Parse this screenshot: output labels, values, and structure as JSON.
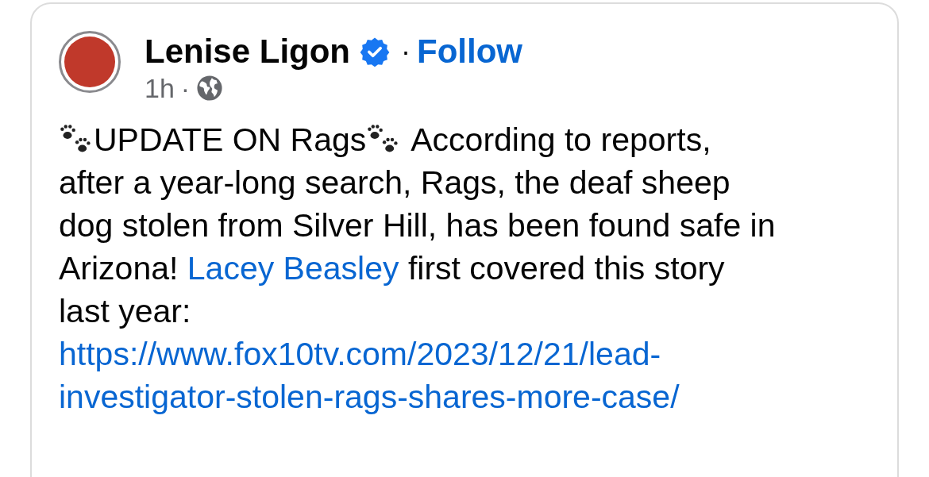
{
  "post": {
    "author": "Lenise Ligon",
    "verified": true,
    "separator": "·",
    "follow": "Follow",
    "time": "1h",
    "time_separator": "·",
    "lines": [
      {
        "kind": "headline",
        "headline": "UPDATE ON Rags",
        "text": "According to reports,"
      },
      {
        "kind": "text",
        "text": "after a year-long search, Rags, the deaf sheep"
      },
      {
        "kind": "text",
        "text": "dog stolen from Silver Hill, has been found safe in"
      },
      {
        "kind": "mention",
        "before": "Arizona!",
        "mention": "Lacey Beasley",
        "after": "first covered this story"
      },
      {
        "kind": "text",
        "text": "last year:"
      }
    ],
    "url": "https://www.fox10tv.com/2023/12/21/lead-investigator-stolen-rags-shares-more-case/"
  }
}
